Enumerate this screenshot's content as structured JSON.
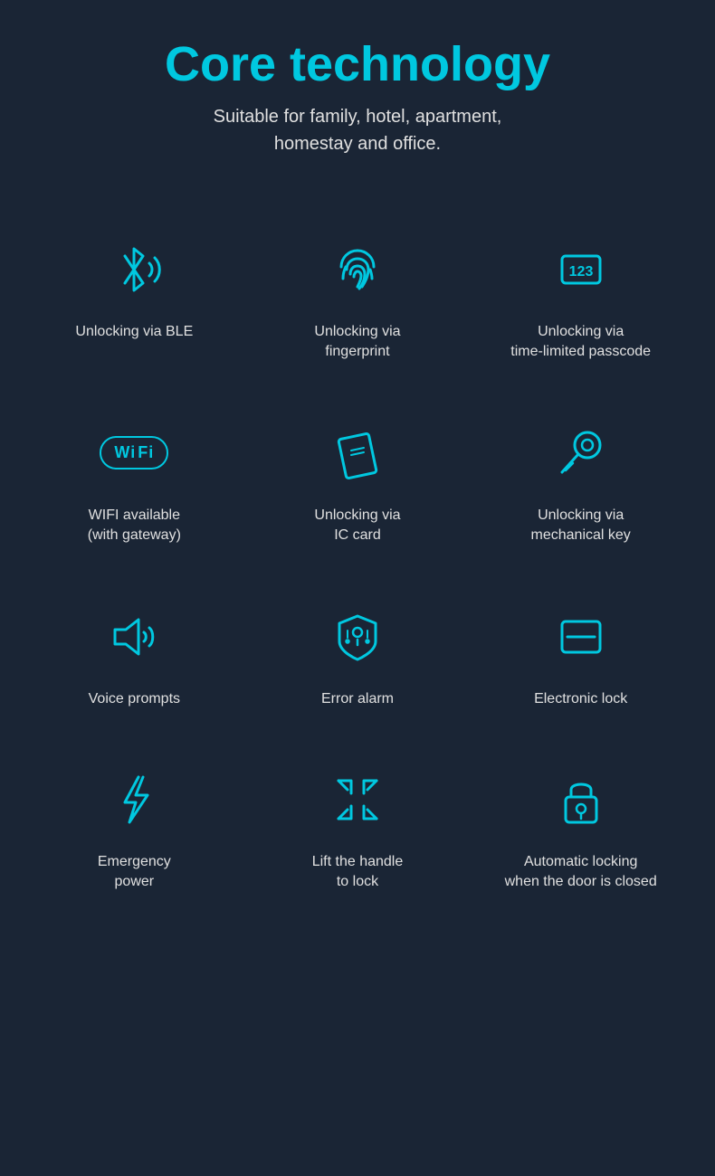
{
  "header": {
    "title": "Core technology",
    "subtitle_line1": "Suitable for family, hotel, apartment,",
    "subtitle_line2": "homestay and office."
  },
  "features": [
    {
      "id": "ble",
      "label": "Unlocking via BLE",
      "icon": "ble"
    },
    {
      "id": "fingerprint",
      "label": "Unlocking via\nfingerprint",
      "icon": "fingerprint"
    },
    {
      "id": "passcode",
      "label": "Unlocking via\ntime-limited passcode",
      "icon": "passcode"
    },
    {
      "id": "wifi",
      "label": "WIFI available\n(with gateway)",
      "icon": "wifi"
    },
    {
      "id": "ic-card",
      "label": "Unlocking via\nIC card",
      "icon": "ic-card"
    },
    {
      "id": "mechanical-key",
      "label": "Unlocking via\nmechanical key",
      "icon": "mechanical-key"
    },
    {
      "id": "voice",
      "label": "Voice prompts",
      "icon": "voice"
    },
    {
      "id": "alarm",
      "label": "Error alarm",
      "icon": "alarm"
    },
    {
      "id": "electronic-lock",
      "label": "Electronic lock",
      "icon": "electronic-lock"
    },
    {
      "id": "emergency-power",
      "label": "Emergency\npower",
      "icon": "emergency-power"
    },
    {
      "id": "lift-handle",
      "label": "Lift the handle\nto lock",
      "icon": "lift-handle"
    },
    {
      "id": "auto-lock",
      "label": "Automatic locking\nwhen the door is closed",
      "icon": "auto-lock"
    }
  ]
}
